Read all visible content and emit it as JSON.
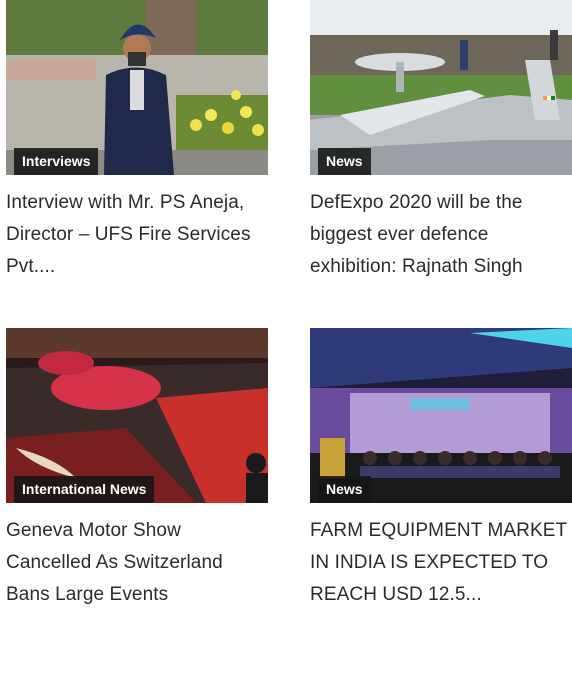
{
  "articles": [
    {
      "category": "Interviews",
      "title": "Interview with Mr. PS Aneja, Director – UFS Fire Services Pvt...."
    },
    {
      "category": "News",
      "title": "DefExpo 2020 will be the biggest ever defence exhibition: Rajnath Singh"
    },
    {
      "category": "International News",
      "title": "Geneva Motor Show Cancelled As Switzerland Bans Large Events"
    },
    {
      "category": "News",
      "title": "FARM EQUIPMENT MARKET IN INDIA IS EXPECTED TO REACH USD 12.5..."
    }
  ]
}
